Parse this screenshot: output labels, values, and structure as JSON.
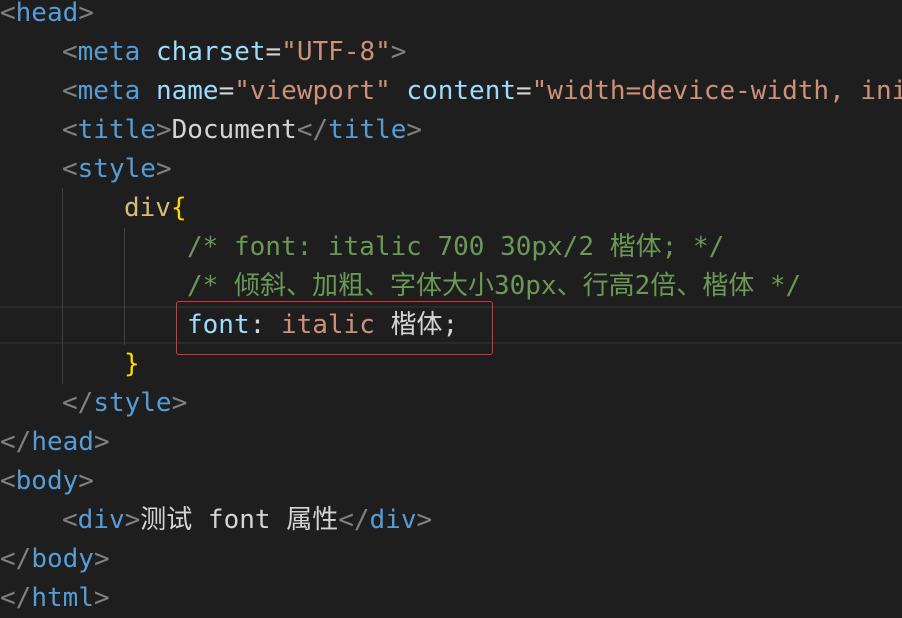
{
  "code": {
    "head_open": "head",
    "meta1_tag": "meta",
    "meta1_attr": "charset",
    "meta1_value": "\"UTF-8\"",
    "meta2_tag": "meta",
    "meta2_attr_name": "name",
    "meta2_value_name": "\"viewport\"",
    "meta2_attr_content": "content",
    "meta2_value_content": "\"width=device-width, ini",
    "title_tag_open": "title",
    "title_text": "Document",
    "title_tag_close": "title",
    "style_open": "style",
    "selector": "div",
    "brace_open": "{",
    "comment1": "/* font: italic 700 30px/2 楷体; */",
    "comment2": "/* 倾斜、加粗、字体大小30px、行高2倍、楷体 */",
    "prop_name": "font",
    "prop_colon": ": ",
    "prop_value1": "italic",
    "prop_value2": " 楷体",
    "prop_semicolon": ";",
    "brace_close": "}",
    "style_close": "style",
    "head_close": "head",
    "body_open": "body",
    "div_open": "div",
    "div_text": "测试 font 属性",
    "div_close": "div",
    "body_close": "body",
    "html_close": "html"
  },
  "colors": {
    "background": "#1e1e1e",
    "punctuation": "#808080",
    "tag": "#569cd6",
    "attribute": "#9cdcfe",
    "string": "#ce9178",
    "comment": "#6a9955",
    "selector": "#d7ba7d",
    "brace": "#ffd700",
    "highlight_border": "#e0313b"
  }
}
